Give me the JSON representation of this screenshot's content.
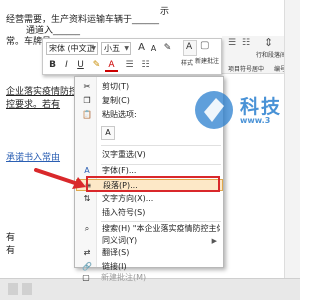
{
  "document": {
    "lines": [
      {
        "text": "经营需要，生产资料运输车辆于______"
      },
      {
        "text": "通道入______"
      },
      {
        "text": "常。车牌号："
      },
      {
        "text": "企业落实疫情防控主体责任，对上述车"
      },
      {
        "text": "控要求。若有"
      },
      {
        "text": "承诺书入常由"
      },
      {
        "text": "有"
      },
      {
        "text": "有"
      }
    ],
    "top_fragment": "示"
  },
  "mini_toolbar": {
    "font_name": "宋体 (中文正",
    "font_size": "小五",
    "bold": "B",
    "italic": "I",
    "underline": "U",
    "grow_font": "A",
    "shrink_font": "A",
    "format_painter": "✎",
    "style_label": "样式",
    "new_comment_label": "新建批注",
    "line_spacing_label": "行和段落间距",
    "center_label": "居中",
    "bullets_label": "项目符号",
    "numbering_label": "编号"
  },
  "context_menu": {
    "items": [
      {
        "label": "剪切(T)",
        "icon": "scissors-icon"
      },
      {
        "label": "复制(C)",
        "icon": "copy-icon"
      },
      {
        "label": "粘贴选项:",
        "icon": "paste-icon"
      },
      {
        "label": "汉字重选(V)",
        "icon": ""
      },
      {
        "label": "字体(F)...",
        "icon": "font-icon"
      },
      {
        "label": "段落(P)...",
        "icon": "paragraph-icon"
      },
      {
        "label": "文字方向(X)...",
        "icon": "text-direction-icon"
      },
      {
        "label": "插入符号(S)",
        "icon": ""
      },
      {
        "label": "搜索(H) \"本企业落实疫情防控主体责任，对...\"",
        "icon": "search-icon"
      },
      {
        "label": "同义词(Y)",
        "icon": ""
      },
      {
        "label": "翻译(S)",
        "icon": "translate-icon"
      },
      {
        "label": "链接(I)",
        "icon": "link-icon"
      },
      {
        "label": "新建批注(M)",
        "icon": "new-comment-icon"
      }
    ],
    "paste_tile": "A",
    "highlighted_index": 5
  },
  "colors": {
    "highlight_box": "#d9282b",
    "watermark": "#2a7fcf",
    "menu_hover": "#fde8c7"
  }
}
